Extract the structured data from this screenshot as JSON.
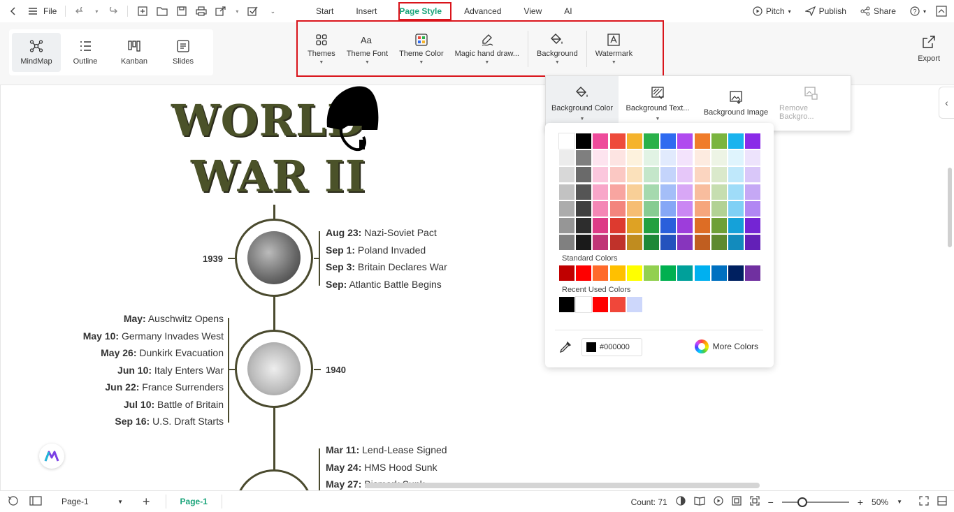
{
  "topbar": {
    "file_label": "File",
    "menu_tabs": [
      {
        "label": "Start"
      },
      {
        "label": "Insert"
      },
      {
        "label": "Page Style"
      },
      {
        "label": "Advanced"
      },
      {
        "label": "View"
      },
      {
        "label": "AI"
      }
    ],
    "active_tab": "Page Style",
    "right": {
      "pitch": "Pitch",
      "publish": "Publish",
      "share": "Share"
    }
  },
  "ribbon": {
    "views": [
      {
        "label": "MindMap",
        "icon": "mindmap-icon"
      },
      {
        "label": "Outline",
        "icon": "outline-icon"
      },
      {
        "label": "Kanban",
        "icon": "kanban-icon"
      },
      {
        "label": "Slides",
        "icon": "slides-icon"
      }
    ],
    "page_style": {
      "themes": "Themes",
      "theme_font": "Theme Font",
      "theme_color": "Theme Color",
      "magic_hand_drawn": "Magic hand draw...",
      "background": "Background",
      "watermark": "Watermark"
    },
    "export": "Export"
  },
  "background_menu": {
    "items": [
      {
        "label": "Background Color"
      },
      {
        "label": "Background Text..."
      },
      {
        "label": "Background Image"
      },
      {
        "label": "Remove Backgro..."
      }
    ]
  },
  "color_picker": {
    "palette": [
      [
        "#ffffff",
        "#000000",
        "#ee4b9b",
        "#ee4b3b",
        "#f5b32c",
        "#2ab14a",
        "#2f6bf0",
        "#b04bef",
        "#f07c2a",
        "#7bb53f",
        "#1ab3ee",
        "#8a2be8"
      ],
      [
        "#ececec",
        "#7f7f7f",
        "#fde4ef",
        "#fde4e2",
        "#fdf2dd",
        "#e1f3e4",
        "#e1eafd",
        "#f3e3fc",
        "#fdebe0",
        "#edf4e5",
        "#dff4fd",
        "#ede3fc"
      ],
      [
        "#d8d8d8",
        "#6a6a6a",
        "#fbc7dd",
        "#fbc8c3",
        "#fbe1bb",
        "#c4e6ca",
        "#c4d4fb",
        "#e6c7f9",
        "#fbd5c0",
        "#dae9cb",
        "#bfe8fb",
        "#d9c7f9"
      ],
      [
        "#c2c2c2",
        "#555555",
        "#f8a6c9",
        "#f8a5a0",
        "#f8cf97",
        "#a5d9ae",
        "#a4bef8",
        "#d8a7f6",
        "#f8bd9e",
        "#c6deb0",
        "#9fdcf8",
        "#c5a8f5"
      ],
      [
        "#acacac",
        "#404040",
        "#f487b5",
        "#f3857d",
        "#f6bd73",
        "#86cc92",
        "#86a7f6",
        "#ca87f3",
        "#f6a67c",
        "#b2d294",
        "#7fd0f5",
        "#b187f3"
      ],
      [
        "#969696",
        "#2d2d2d",
        "#dd3b87",
        "#dd3a2f",
        "#dea224",
        "#22a040",
        "#2a5fdb",
        "#9d3ddb",
        "#dd6d25",
        "#6ea037",
        "#15a1d9",
        "#7425d4"
      ],
      [
        "#808080",
        "#1a1a1a",
        "#c03577",
        "#c0322a",
        "#c08c1f",
        "#1d8837",
        "#2452bd",
        "#8735bd",
        "#c05e20",
        "#5e8a2f",
        "#128bbd",
        "#6320b7"
      ]
    ],
    "standard_label": "Standard Colors",
    "standard": [
      "#c00000",
      "#ff0000",
      "#ff6a2b",
      "#ffc000",
      "#ffff00",
      "#92d050",
      "#00b050",
      "#00a09a",
      "#00b0f0",
      "#0070c0",
      "#002060",
      "#7030a0"
    ],
    "recent_label": "Recent Used Colors",
    "recent": [
      "#000000",
      "#ffffff",
      "#ff0000",
      "#f0473a",
      "#cdd7fb"
    ],
    "hex_value": "#000000",
    "more_colors": "More Colors"
  },
  "canvas": {
    "title_line1": "WORLD",
    "title_line2": "WAR II",
    "nodes": [
      {
        "year": "1939",
        "events": [
          {
            "date": "Aug 23:",
            "text": " Nazi-Soviet Pact"
          },
          {
            "date": "Sep 1:",
            "text": " Poland Invaded"
          },
          {
            "date": "Sep 3:",
            "text": " Britain Declares War"
          },
          {
            "date": "Sep:",
            "text": " Atlantic Battle Begins"
          }
        ]
      },
      {
        "year": "1940",
        "events": [
          {
            "date": "May:",
            "text": " Auschwitz Opens"
          },
          {
            "date": "May 10:",
            "text": " Germany Invades West"
          },
          {
            "date": "May 26:",
            "text": " Dunkirk Evacuation"
          },
          {
            "date": "Jun 10:",
            "text": " Italy Enters War"
          },
          {
            "date": "Jun 22:",
            "text": " France Surrenders"
          },
          {
            "date": "Jul 10:",
            "text": " Battle of Britain"
          },
          {
            "date": "Sep 16:",
            "text": " U.S. Draft Starts"
          }
        ]
      },
      {
        "events": [
          {
            "date": "Mar 11:",
            "text": " Lend-Lease Signed"
          },
          {
            "date": "May 24:",
            "text": " HMS Hood Sunk"
          },
          {
            "date": "May 27:",
            "text": " Bismark Sunk"
          }
        ]
      }
    ]
  },
  "statusbar": {
    "page_select": "Page-1",
    "page_tab": "Page-1",
    "count": "Count: 71",
    "zoom": "50%"
  },
  "colors": {
    "accent": "#1aa47a",
    "highlight_red": "#d9141b",
    "timeline": "#4a4a2e"
  }
}
